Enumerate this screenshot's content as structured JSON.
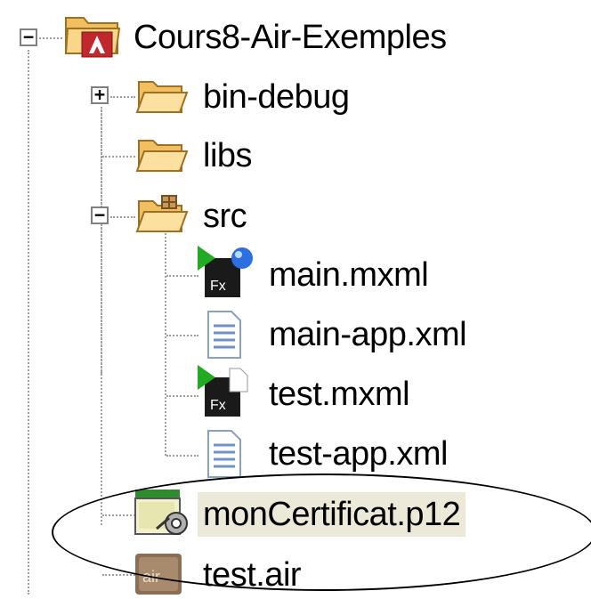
{
  "tree": {
    "root": {
      "label": "Cours8-Air-Exemples",
      "icon": "air-project-icon",
      "expanded": true
    },
    "items": [
      {
        "label": "bin-debug",
        "icon": "folder-icon",
        "expandable": true,
        "expanded": false
      },
      {
        "label": "libs",
        "icon": "folder-icon",
        "expandable": false
      },
      {
        "label": "src",
        "icon": "source-folder-icon",
        "expandable": true,
        "expanded": true
      },
      {
        "label": "main.mxml",
        "icon": "flex-main-app-icon"
      },
      {
        "label": "main-app.xml",
        "icon": "xml-file-icon"
      },
      {
        "label": "test.mxml",
        "icon": "flex-mxml-icon"
      },
      {
        "label": "test-app.xml",
        "icon": "xml-file-icon"
      },
      {
        "label": "monCertificat.p12",
        "icon": "certificate-icon",
        "selected": true
      },
      {
        "label": "test.air",
        "icon": "air-package-icon"
      }
    ],
    "toggle_symbols": {
      "expanded": "−",
      "collapsed": "+"
    },
    "icon_texts": {
      "fx": "Fx",
      "air": "air"
    }
  },
  "colors": {
    "selection": "#ece9d8",
    "folder": "#f5c66a",
    "air_red": "#c0282d"
  }
}
